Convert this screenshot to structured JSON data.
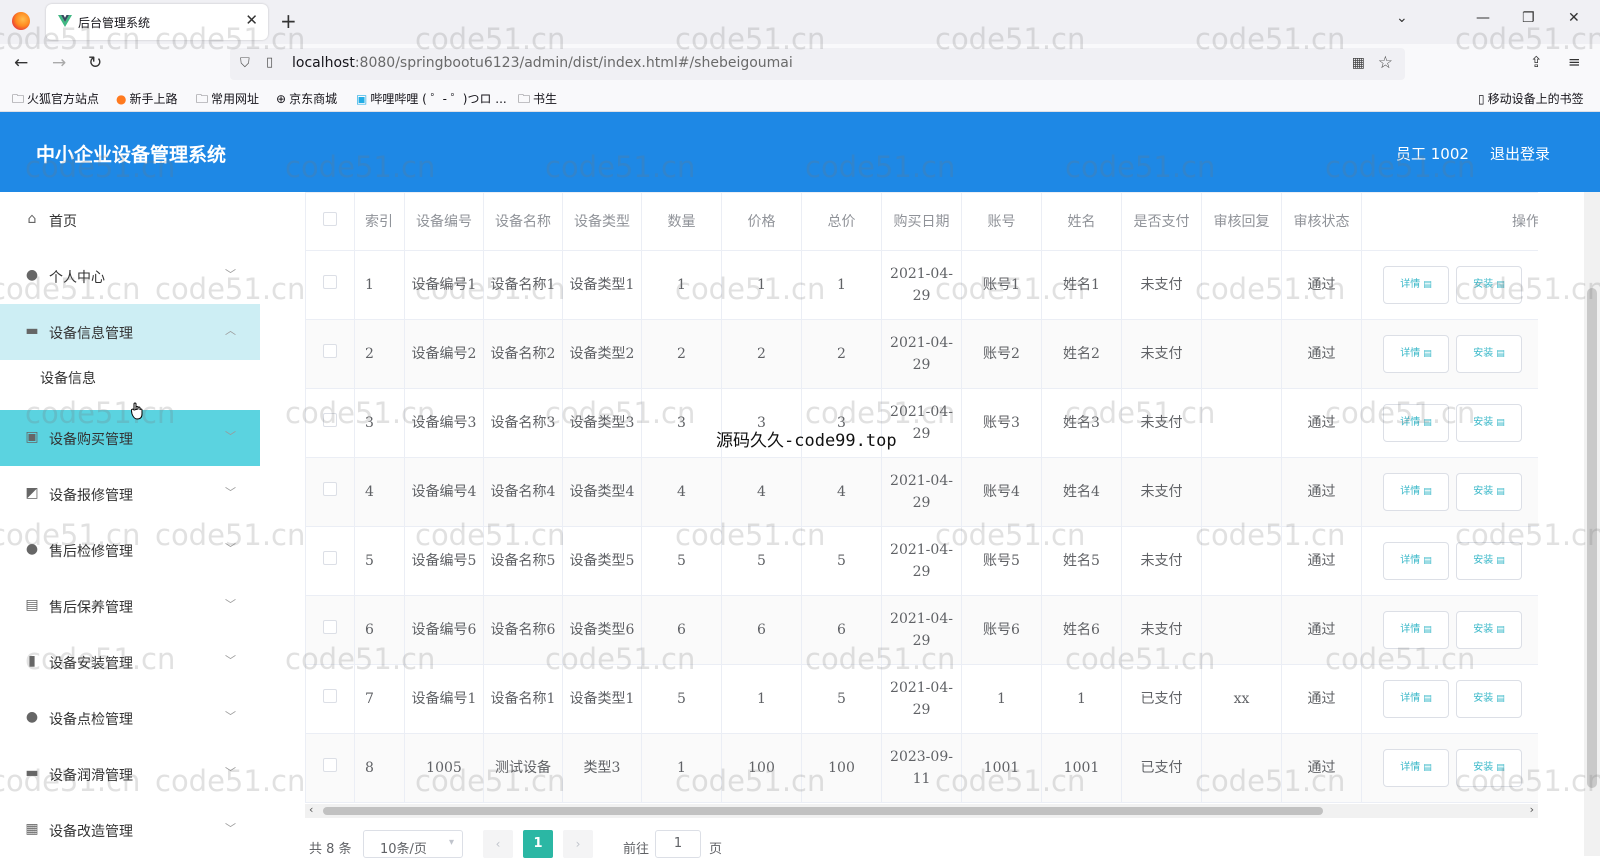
{
  "browser": {
    "tab_title": "后台管理系统",
    "url_host": "localhost",
    "url_rest": ":8080/springbootu6123/admin/dist/index.html#/shebeigoumai",
    "bookmarks": [
      "火狐官方站点",
      "新手上路",
      "常用网址",
      "京东商城",
      "哔哩哔哩 ( ゜- ゜)つロ ...",
      "书生"
    ],
    "mobile_bookmarks": "移动设备上的书签"
  },
  "header": {
    "title": "中小企业设备管理系统",
    "user": "员工 1002",
    "logout": "退出登录"
  },
  "sidebar": {
    "items": [
      {
        "label": "首页",
        "icon": "home-icon"
      },
      {
        "label": "个人中心",
        "icon": "user-icon"
      },
      {
        "label": "设备信息管理",
        "icon": "briefcase-icon"
      },
      {
        "label": "设备购买管理",
        "icon": "cart-icon"
      },
      {
        "label": "设备报修管理",
        "icon": "chart-icon"
      },
      {
        "label": "售后检修管理",
        "icon": "user-icon"
      },
      {
        "label": "售后保养管理",
        "icon": "clipboard-icon"
      },
      {
        "label": "设备安装管理",
        "icon": "bar-chart-icon"
      },
      {
        "label": "设备点检管理",
        "icon": "bulb-icon"
      },
      {
        "label": "设备润滑管理",
        "icon": "monitor-icon"
      },
      {
        "label": "设备改造管理",
        "icon": "grid-icon"
      }
    ],
    "sub_item": "设备信息"
  },
  "table": {
    "headers": [
      "索引",
      "设备编号",
      "设备名称",
      "设备类型",
      "数量",
      "价格",
      "总价",
      "购买日期",
      "账号",
      "姓名",
      "是否支付",
      "审核回复",
      "审核状态",
      "操作"
    ],
    "rows": [
      {
        "idx": "1",
        "code": "设备编号1",
        "name": "设备名称1",
        "type": "设备类型1",
        "qty": "1",
        "price": "1",
        "total": "1",
        "date": "2021-04-29",
        "acct": "账号1",
        "person": "姓名1",
        "paid": "未支付",
        "reply": "",
        "status": "通过"
      },
      {
        "idx": "2",
        "code": "设备编号2",
        "name": "设备名称2",
        "type": "设备类型2",
        "qty": "2",
        "price": "2",
        "total": "2",
        "date": "2021-04-29",
        "acct": "账号2",
        "person": "姓名2",
        "paid": "未支付",
        "reply": "",
        "status": "通过"
      },
      {
        "idx": "3",
        "code": "设备编号3",
        "name": "设备名称3",
        "type": "设备类型3",
        "qty": "3",
        "price": "3",
        "total": "3",
        "date": "2021-04-29",
        "acct": "账号3",
        "person": "姓名3",
        "paid": "未支付",
        "reply": "",
        "status": "通过"
      },
      {
        "idx": "4",
        "code": "设备编号4",
        "name": "设备名称4",
        "type": "设备类型4",
        "qty": "4",
        "price": "4",
        "total": "4",
        "date": "2021-04-29",
        "acct": "账号4",
        "person": "姓名4",
        "paid": "未支付",
        "reply": "",
        "status": "通过"
      },
      {
        "idx": "5",
        "code": "设备编号5",
        "name": "设备名称5",
        "type": "设备类型5",
        "qty": "5",
        "price": "5",
        "total": "5",
        "date": "2021-04-29",
        "acct": "账号5",
        "person": "姓名5",
        "paid": "未支付",
        "reply": "",
        "status": "通过"
      },
      {
        "idx": "6",
        "code": "设备编号6",
        "name": "设备名称6",
        "type": "设备类型6",
        "qty": "6",
        "price": "6",
        "total": "6",
        "date": "2021-04-29",
        "acct": "账号6",
        "person": "姓名6",
        "paid": "未支付",
        "reply": "",
        "status": "通过"
      },
      {
        "idx": "7",
        "code": "设备编号1",
        "name": "设备名称1",
        "type": "设备类型1",
        "qty": "5",
        "price": "1",
        "total": "5",
        "date": "2021-04-29",
        "acct": "1",
        "person": "1",
        "paid": "已支付",
        "reply": "xx",
        "status": "通过"
      },
      {
        "idx": "8",
        "code": "1005",
        "name": "测试设备",
        "type": "类型3",
        "qty": "1",
        "price": "100",
        "total": "100",
        "date": "2023-09-11",
        "acct": "1001",
        "person": "1001",
        "paid": "已支付",
        "reply": "",
        "status": "通过"
      }
    ],
    "detail_label": "详情",
    "install_label": "安装"
  },
  "pagination": {
    "total": "共 8 条",
    "page_size": "10条/页",
    "current": "1",
    "goto_label": "前往",
    "goto_value": "1",
    "page_label": "页"
  },
  "watermark": "code51.cn",
  "center_watermark": "源码久久-code99.top",
  "colors": {
    "header_bg": "#1e88e5",
    "active_menu": "#5bd3e0",
    "open_menu": "#cdeef4",
    "accent": "#2bb7a4"
  }
}
